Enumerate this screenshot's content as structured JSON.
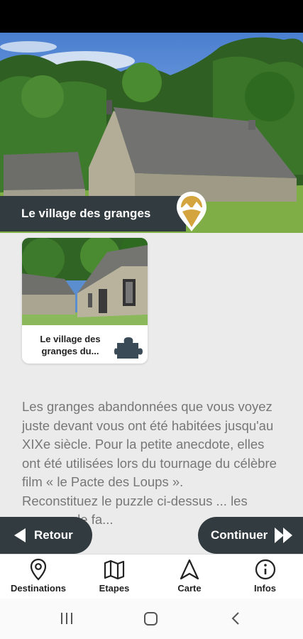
{
  "page": {
    "title": "Le village des granges"
  },
  "puzzle_card": {
    "label": "Le village des granges du..."
  },
  "description": {
    "paragraph1": "Les granges abandonnées que vous voyez juste devant vous ont été habitées jusqu'au XIXe siècle. Pour la petite anecdote, elles ont été utilisées lors du tournage du célèbre film « le Pacte des Loups ».",
    "paragraph2": "Reconstituez le puzzle ci-dessus ... les granges de fa..."
  },
  "buttons": {
    "back": "Retour",
    "next": "Continuer"
  },
  "tabs": [
    {
      "label": "Destinations",
      "icon": "location-pin-icon"
    },
    {
      "label": "Etapes",
      "icon": "map-icon"
    },
    {
      "label": "Carte",
      "icon": "navigation-arrow-icon"
    },
    {
      "label": "Infos",
      "icon": "info-icon"
    }
  ],
  "colors": {
    "dark": "#323b40",
    "accent": "#d4a53f",
    "background": "#ebebeb",
    "text_muted": "#777777"
  }
}
